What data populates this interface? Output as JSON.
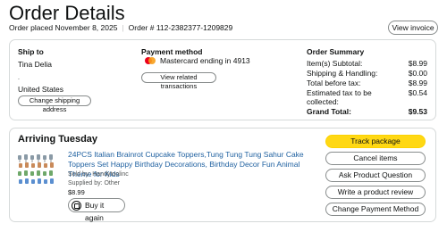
{
  "header": {
    "title": "Order Details",
    "order_placed": "Order placed November 8, 2025",
    "order_number": "Order # 112-2382377-1209829",
    "view_invoice": "View invoice"
  },
  "ship_to": {
    "heading": "Ship to",
    "name": "Tina Delia",
    "dot": ".",
    "country": "United States",
    "change_button": "Change shipping address"
  },
  "payment": {
    "heading": "Payment method",
    "card_text": "Mastercard ending in 4913",
    "view_transactions": "View related transactions"
  },
  "summary": {
    "heading": "Order Summary",
    "rows": [
      {
        "label": "Item(s) Subtotal:",
        "value": "$8.99"
      },
      {
        "label": "Shipping & Handling:",
        "value": "$0.00"
      },
      {
        "label": "Total before tax:",
        "value": "$8.99"
      },
      {
        "label": "Estimated tax to be collected:",
        "value": "$0.54"
      }
    ],
    "grand_total_label": "Grand Total:",
    "grand_total_value": "$9.53"
  },
  "shipment": {
    "arriving": "Arriving Tuesday",
    "product_title": "24PCS Italian Brainrot Cupcake Toppers,Tung Tung Tung Sahur Cake Toppers Set Happy Birthday Decorations, Birthday Decor Fun Animal Theme for Kids",
    "sold_by": "Sold by: Handytoolinc",
    "supplied_by": "Supplied by: Other",
    "price": "$8.99",
    "buy_again": "Buy it again",
    "actions": [
      "Track package",
      "Cancel items",
      "Ask Product Question",
      "Write a product review",
      "Change Payment Method"
    ]
  },
  "colors": {
    "link": "#2162a1",
    "primary_button": "#ffd814",
    "border": "#d5d9d9"
  }
}
